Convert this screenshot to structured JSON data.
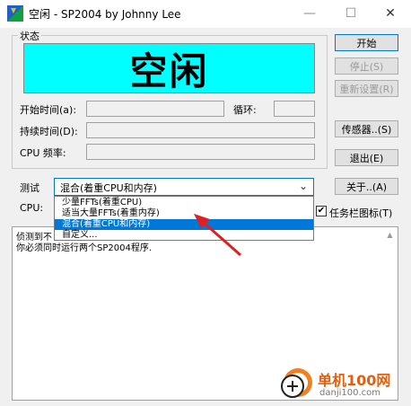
{
  "window": {
    "title": "空闲 - SP2004 by Johnny Lee",
    "minimize_glyph": "—",
    "maximize_glyph": "☐",
    "close_glyph": "✕"
  },
  "status": {
    "group_label": "状态",
    "big_text": "空闲",
    "panel_color": "#00ffff",
    "start_time_label": "开始时间(a):",
    "loop_label": "循环:",
    "duration_label": "持续时间(D):",
    "cpu_freq_label": "CPU 频率:"
  },
  "buttons": {
    "start": "开始",
    "stop": "停止(S)",
    "reset": "重新设置(R)",
    "sensor": "传感器..(S)",
    "exit": "退出(E)",
    "about": "关于..(A)"
  },
  "test": {
    "label": "测试",
    "selected": "混合(着重CPU和内存)",
    "options": [
      "少量FFTs(着重CPU)",
      "适当大量FFTs(着重内存)",
      "混合(着重CPU和内存)",
      "自定义..."
    ],
    "highlighted_index": 2
  },
  "cpu": {
    "label": "CPU:"
  },
  "taskbar": {
    "label": "任务栏图标(T)",
    "checked": true
  },
  "log": {
    "lines": [
      "侦测到不",
      "你必须同时运行两个SP2004程序."
    ]
  },
  "watermark": {
    "site": "单机100网",
    "url": "danji100.com"
  },
  "colors": {
    "accent": "#0078d7",
    "arrow": "#e02020"
  }
}
